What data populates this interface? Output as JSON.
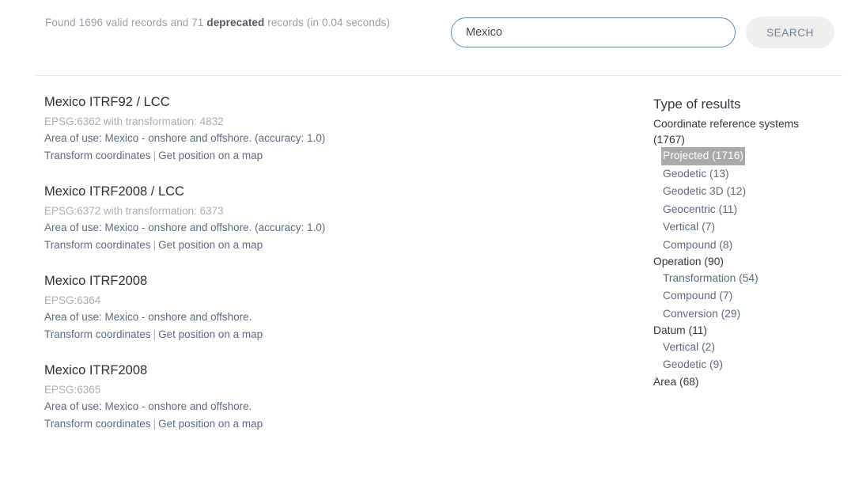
{
  "header": {
    "found_prefix": "Found 1696 valid records and 71 ",
    "deprecated_label": "deprecated",
    "found_suffix": " records (in 0.04 seconds)"
  },
  "search": {
    "value": "Mexico",
    "placeholder": "Search",
    "button_label": "SEARCH"
  },
  "results": [
    {
      "title": "Mexico ITRF92 / LCC",
      "epsg": "EPSG:6362 with transformation: 4832",
      "area": "Area of use: Mexico - onshore and offshore. (accuracy: 1.0)",
      "link_transform": "Transform coordinates",
      "separator": "|",
      "link_map": "Get position on a map"
    },
    {
      "title": "Mexico ITRF2008 / LCC",
      "epsg": "EPSG:6372 with transformation: 6373",
      "area": "Area of use: Mexico - onshore and offshore. (accuracy: 1.0)",
      "link_transform": "Transform coordinates",
      "separator": "|",
      "link_map": "Get position on a map"
    },
    {
      "title": "Mexico ITRF2008",
      "epsg": "EPSG:6364",
      "area": "Area of use: Mexico - onshore and offshore.",
      "link_transform": "Transform coordinates",
      "separator": "|",
      "link_map": "Get position on a map"
    },
    {
      "title": "Mexico ITRF2008",
      "epsg": "EPSG:6365",
      "area": "Area of use: Mexico - onshore and offshore.",
      "link_transform": "Transform coordinates",
      "separator": "|",
      "link_map": "Get position on a map"
    }
  ],
  "facets": {
    "title": "Type of results",
    "groups": [
      {
        "label": "Coordinate reference systems (1767)",
        "items": [
          {
            "label": "Projected (1716)",
            "selected": true
          },
          {
            "label": "Geodetic (13)",
            "selected": false
          },
          {
            "label": "Geodetic 3D (12)",
            "selected": false
          },
          {
            "label": "Geocentric (11)",
            "selected": false
          },
          {
            "label": "Vertical (7)",
            "selected": false
          },
          {
            "label": "Compound (8)",
            "selected": false
          }
        ]
      },
      {
        "label": "Operation (90)",
        "items": [
          {
            "label": "Transformation (54)",
            "selected": false
          },
          {
            "label": "Compound (7)",
            "selected": false
          },
          {
            "label": "Conversion (29)",
            "selected": false
          }
        ]
      },
      {
        "label": "Datum (11)",
        "items": [
          {
            "label": "Vertical (2)",
            "selected": false
          },
          {
            "label": "Geodetic (9)",
            "selected": false
          }
        ]
      },
      {
        "label": "Area (68)",
        "items": []
      }
    ]
  },
  "colors": {
    "accent_border": "#4c90c4",
    "link": "#5d6b82",
    "muted": "#aeaeae",
    "selected_bg": "#aaaaaa"
  }
}
